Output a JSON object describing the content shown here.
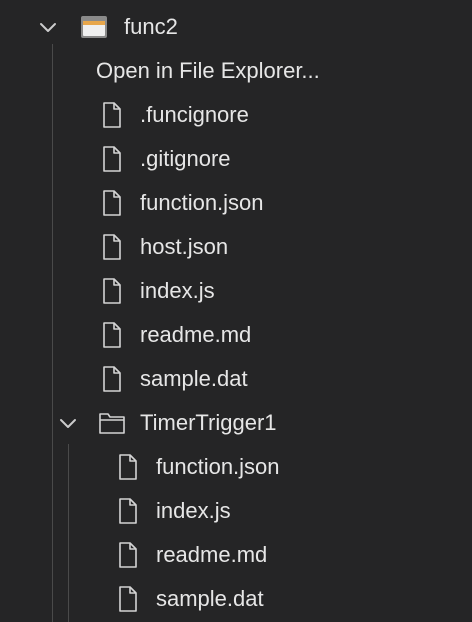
{
  "explorer": {
    "root": {
      "name": "func2",
      "expanded": true,
      "icon": "folder-open-icon",
      "accent": "#e8a74b"
    },
    "context_action": "Open in File Explorer...",
    "files": [
      {
        "name": ".funcignore",
        "icon": "file-icon"
      },
      {
        "name": ".gitignore",
        "icon": "file-icon"
      },
      {
        "name": "function.json",
        "icon": "file-icon"
      },
      {
        "name": "host.json",
        "icon": "file-icon"
      },
      {
        "name": "index.js",
        "icon": "file-icon"
      },
      {
        "name": "readme.md",
        "icon": "file-icon"
      },
      {
        "name": "sample.dat",
        "icon": "file-icon"
      }
    ],
    "subfolder": {
      "name": "TimerTrigger1",
      "expanded": true,
      "icon": "folder-icon",
      "files": [
        {
          "name": "function.json",
          "icon": "file-icon"
        },
        {
          "name": "index.js",
          "icon": "file-icon"
        },
        {
          "name": "readme.md",
          "icon": "file-icon"
        },
        {
          "name": "sample.dat",
          "icon": "file-icon"
        }
      ]
    }
  }
}
